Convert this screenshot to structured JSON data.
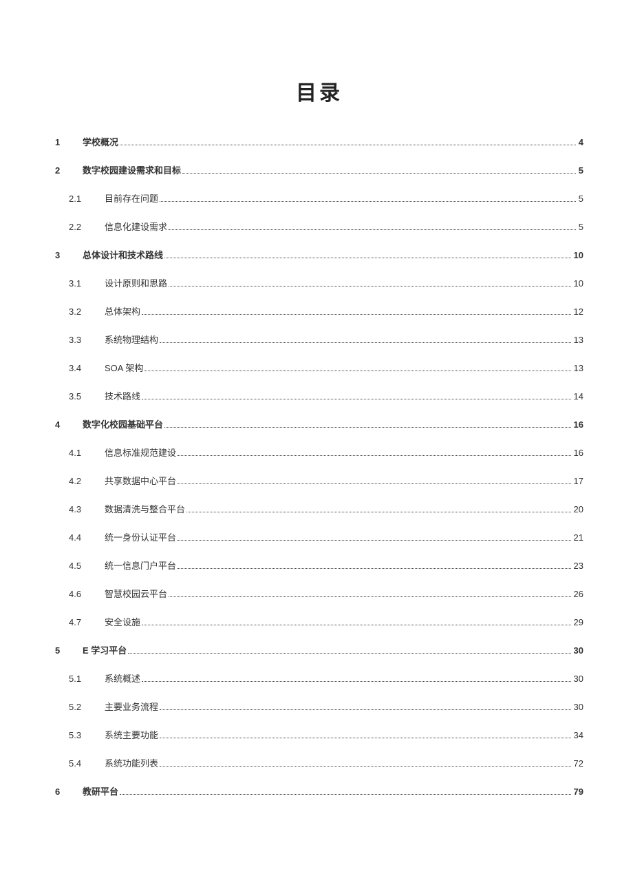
{
  "title": "目录",
  "entries": [
    {
      "level": 1,
      "num": "1",
      "label": "学校概况",
      "page": "4"
    },
    {
      "level": 1,
      "num": "2",
      "label": "数字校园建设需求和目标",
      "page": "5"
    },
    {
      "level": 2,
      "num": "2.1",
      "label": "目前存在问题",
      "page": "5"
    },
    {
      "level": 2,
      "num": "2.2",
      "label": "信息化建设需求",
      "page": "5"
    },
    {
      "level": 1,
      "num": "3",
      "label": "总体设计和技术路线",
      "page": "10"
    },
    {
      "level": 2,
      "num": "3.1",
      "label": "设计原则和思路",
      "page": "10"
    },
    {
      "level": 2,
      "num": "3.2",
      "label": "总体架构",
      "page": "12"
    },
    {
      "level": 2,
      "num": "3.3",
      "label": "系统物理结构",
      "page": "13"
    },
    {
      "level": 2,
      "num": "3.4",
      "label": "SOA 架构",
      "page": "13"
    },
    {
      "level": 2,
      "num": "3.5",
      "label": "技术路线",
      "page": "14"
    },
    {
      "level": 1,
      "num": "4",
      "label": "数字化校园基础平台",
      "page": "16"
    },
    {
      "level": 2,
      "num": "4.1",
      "label": "信息标准规范建设",
      "page": "16"
    },
    {
      "level": 2,
      "num": "4.2",
      "label": "共享数据中心平台",
      "page": "17"
    },
    {
      "level": 2,
      "num": "4.3",
      "label": "数据清洗与整合平台",
      "page": "20"
    },
    {
      "level": 2,
      "num": "4.4",
      "label": "统一身份认证平台",
      "page": "21"
    },
    {
      "level": 2,
      "num": "4.5",
      "label": "统一信息门户平台",
      "page": "23"
    },
    {
      "level": 2,
      "num": "4.6",
      "label": "智慧校园云平台",
      "page": "26"
    },
    {
      "level": 2,
      "num": "4.7",
      "label": "安全设施",
      "page": "29"
    },
    {
      "level": 1,
      "num": "5",
      "label": "E 学习平台",
      "page": "30"
    },
    {
      "level": 2,
      "num": "5.1",
      "label": "系统概述",
      "page": "30"
    },
    {
      "level": 2,
      "num": "5.2",
      "label": "主要业务流程",
      "page": "30"
    },
    {
      "level": 2,
      "num": "5.3",
      "label": "系统主要功能",
      "page": "34"
    },
    {
      "level": 2,
      "num": "5.4",
      "label": "系统功能列表",
      "page": "72"
    },
    {
      "level": 1,
      "num": "6",
      "label": "教研平台",
      "page": "79"
    }
  ]
}
